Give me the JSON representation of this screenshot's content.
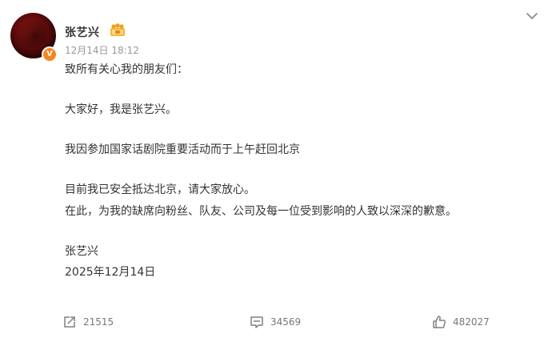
{
  "post": {
    "author": "张艺兴",
    "verified_badge": "V",
    "timestamp": "12月14日 18:12",
    "lines": {
      "l1": "致所有关心我的朋友们：",
      "l2": "大家好，我是张艺兴。",
      "l3": "我因参加国家话剧院重要活动而于上午赶回北京",
      "l4": "目前我已安全抵达北京，请大家放心。",
      "l5": "在此，为我的缺席向粉丝、队友、公司及每一位受到影响的人致以深深的歉意。",
      "l6": "张艺兴",
      "l7": "2025年12月14日"
    }
  },
  "actions": {
    "repost_count": "21515",
    "comment_count": "34569",
    "like_count": "482027"
  },
  "colors": {
    "verified": "#f7841e",
    "text": "#333333",
    "muted": "#999999"
  },
  "icons": [
    "avatar",
    "verified-icon",
    "fan-badge-icon",
    "chevron-down-icon",
    "repost-icon",
    "comment-icon",
    "like-icon"
  ]
}
